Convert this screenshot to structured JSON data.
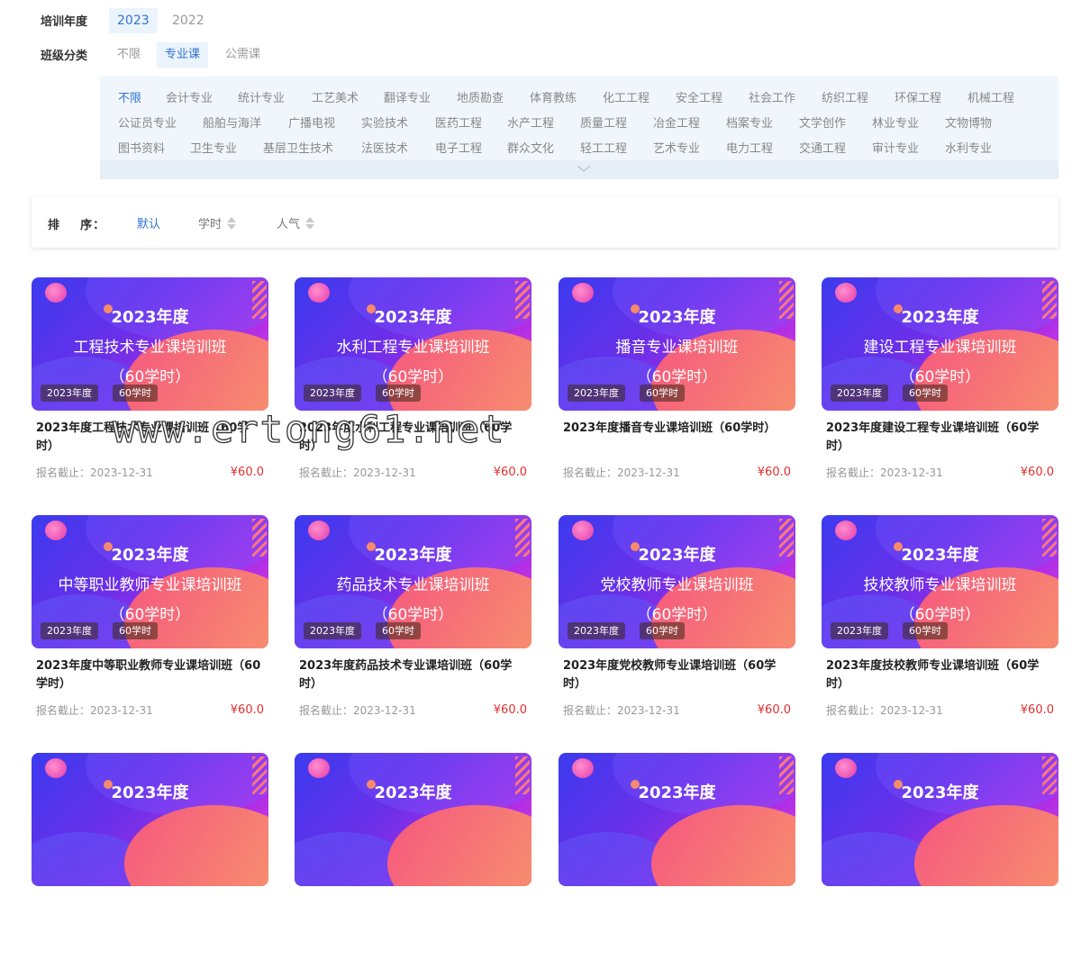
{
  "filters": {
    "year": {
      "label": "培训年度",
      "options": [
        "2023",
        "2022"
      ],
      "active": "2023"
    },
    "class_type": {
      "label": "班级分类",
      "options": [
        "不限",
        "专业课",
        "公需课"
      ],
      "active": "专业课"
    },
    "majors": {
      "active": "不限",
      "rows": [
        [
          "不限",
          "会计专业",
          "统计专业",
          "工艺美术",
          "翻译专业",
          "地质勘查",
          "体育教练",
          "化工工程",
          "安全工程",
          "社会工作",
          "纺织工程",
          "环保工程",
          "机械工程"
        ],
        [
          "公证员专业",
          "船舶与海洋",
          "广播电视",
          "实验技术",
          "医药工程",
          "水产工程",
          "质量工程",
          "冶金工程",
          "档案专业",
          "文学创作",
          "林业专业",
          "文物博物"
        ],
        [
          "图书资料",
          "卫生专业",
          "基层卫生技术",
          "法医技术",
          "电子工程",
          "群众文化",
          "轻工工程",
          "艺术专业",
          "电力工程",
          "交通工程",
          "审计专业",
          "水利专业"
        ]
      ]
    }
  },
  "sort": {
    "label": "排    序：",
    "options": [
      "默认",
      "学时",
      "人气"
    ],
    "active": "默认"
  },
  "courses": [
    {
      "banner_year": "2023年度",
      "banner_name": "工程技术专业课培训班",
      "banner_hours": "（60学时）",
      "tag_year": "2023年度",
      "tag_hours": "60学时",
      "title": "2023年度工程技术专业课培训班（60学时）",
      "deadline": "报名截止：2023-12-31",
      "price": "¥60.0"
    },
    {
      "banner_year": "2023年度",
      "banner_name": "水利工程专业课培训班",
      "banner_hours": "（60学时）",
      "tag_year": "2023年度",
      "tag_hours": "60学时",
      "title": "2023年度水利工程专业课培训班（60学时）",
      "deadline": "报名截止：2023-12-31",
      "price": "¥60.0"
    },
    {
      "banner_year": "2023年度",
      "banner_name": "播音专业课培训班",
      "banner_hours": "（60学时）",
      "tag_year": "2023年度",
      "tag_hours": "60学时",
      "title": "2023年度播音专业课培训班（60学时）",
      "deadline": "报名截止：2023-12-31",
      "price": "¥60.0"
    },
    {
      "banner_year": "2023年度",
      "banner_name": "建设工程专业课培训班",
      "banner_hours": "（60学时）",
      "tag_year": "2023年度",
      "tag_hours": "60学时",
      "title": "2023年度建设工程专业课培训班（60学时）",
      "deadline": "报名截止：2023-12-31",
      "price": "¥60.0"
    },
    {
      "banner_year": "2023年度",
      "banner_name": "中等职业教师专业课培训班",
      "banner_hours": "（60学时）",
      "tag_year": "2023年度",
      "tag_hours": "60学时",
      "title": "2023年度中等职业教师专业课培训班（60学时）",
      "deadline": "报名截止：2023-12-31",
      "price": "¥60.0"
    },
    {
      "banner_year": "2023年度",
      "banner_name": "药品技术专业课培训班",
      "banner_hours": "（60学时）",
      "tag_year": "2023年度",
      "tag_hours": "60学时",
      "title": "2023年度药品技术专业课培训班（60学时）",
      "deadline": "报名截止：2023-12-31",
      "price": "¥60.0"
    },
    {
      "banner_year": "2023年度",
      "banner_name": "党校教师专业课培训班",
      "banner_hours": "（60学时）",
      "tag_year": "2023年度",
      "tag_hours": "60学时",
      "title": "2023年度党校教师专业课培训班（60学时）",
      "deadline": "报名截止：2023-12-31",
      "price": "¥60.0"
    },
    {
      "banner_year": "2023年度",
      "banner_name": "技校教师专业课培训班",
      "banner_hours": "（60学时）",
      "tag_year": "2023年度",
      "tag_hours": "60学时",
      "title": "2023年度技校教师专业课培训班（60学时）",
      "deadline": "报名截止：2023-12-31",
      "price": "¥60.0"
    },
    {
      "banner_year": "2023年度"
    },
    {
      "banner_year": "2023年度"
    },
    {
      "banner_year": "2023年度"
    },
    {
      "banner_year": "2023年度"
    }
  ],
  "watermark": "www.ertong61.net",
  "colors": {
    "accent": "#2f74d0",
    "price": "#e03030",
    "panel_bg": "#f1f6fc"
  }
}
